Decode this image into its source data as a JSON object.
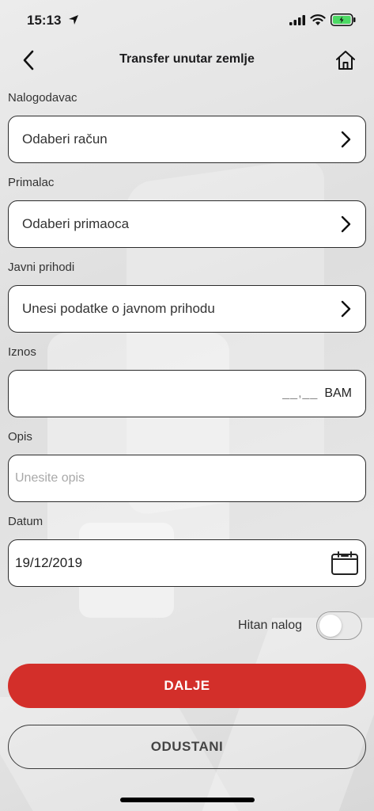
{
  "status_bar": {
    "time": "15:13"
  },
  "nav": {
    "title": "Transfer unutar zemlje"
  },
  "form": {
    "nalogodavac": {
      "label": "Nalogodavac",
      "value": "Odaberi račun"
    },
    "primalac": {
      "label": "Primalac",
      "value": "Odaberi primaoca"
    },
    "javni_prihodi": {
      "label": "Javni prihodi",
      "value": "Unesi podatke o javnom prihodu"
    },
    "iznos": {
      "label": "Iznos",
      "blank": "__,__",
      "currency": "BAM"
    },
    "opis": {
      "label": "Opis",
      "placeholder": "Unesite opis"
    },
    "datum": {
      "label": "Datum",
      "value": "19/12/2019"
    },
    "hitan_nalog": {
      "label": "Hitan nalog",
      "on": false
    }
  },
  "buttons": {
    "primary": "DALJE",
    "secondary": "ODUSTANI"
  },
  "colors": {
    "accent": "#d32f2a",
    "battery": "#4cd964"
  },
  "icons": [
    "location-arrow-icon",
    "signal-icon",
    "wifi-icon",
    "battery-icon",
    "back-arrow-icon",
    "home-icon",
    "chevron-right-icon",
    "calendar-icon"
  ]
}
